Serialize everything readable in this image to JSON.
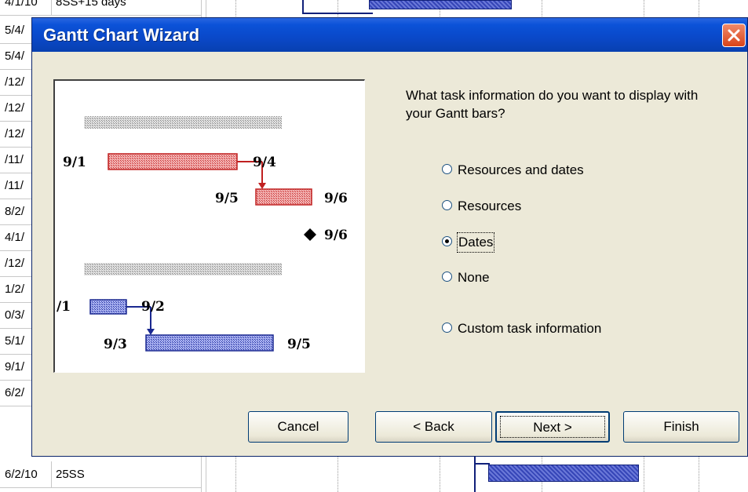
{
  "background_rows": [
    {
      "date": "4/1/10",
      "pred": "8SS+15 days"
    },
    {
      "date": "5/4/",
      "pred": ""
    },
    {
      "date": "5/4/",
      "pred": ""
    },
    {
      "date": "/12/",
      "pred": ""
    },
    {
      "date": "/12/",
      "pred": ""
    },
    {
      "date": "/12/",
      "pred": ""
    },
    {
      "date": "/11/",
      "pred": ""
    },
    {
      "date": "/11/",
      "pred": ""
    },
    {
      "date": "8/2/",
      "pred": ""
    },
    {
      "date": "4/1/",
      "pred": ""
    },
    {
      "date": "/12/",
      "pred": ""
    },
    {
      "date": "1/2/",
      "pred": ""
    },
    {
      "date": "0/3/",
      "pred": ""
    },
    {
      "date": "5/1/",
      "pred": ""
    },
    {
      "date": "9/1/",
      "pred": ""
    },
    {
      "date": "6/2/",
      "pred": ""
    },
    {
      "date": "6/2/10",
      "pred": "25SS"
    }
  ],
  "dialog": {
    "title": "Gantt Chart Wizard",
    "question": "What task information do you want to display with your Gantt bars?",
    "options": [
      {
        "label": "Resources and dates",
        "selected": false
      },
      {
        "label": "Resources",
        "selected": false
      },
      {
        "label": "Dates",
        "selected": true
      },
      {
        "label": "None",
        "selected": false
      },
      {
        "label": "Custom task information",
        "selected": false
      }
    ],
    "buttons": {
      "cancel": "Cancel",
      "back": "< Back",
      "next": "Next >",
      "finish": "Finish"
    }
  },
  "preview": {
    "labels": {
      "red_start": "9/1",
      "red_link": "9/4",
      "red2_start": "9/5",
      "red2_end": "9/6",
      "milestone": "9/6",
      "blue_start": "/1",
      "blue_link": "9/2",
      "blue2_start": "9/3",
      "blue2_end": "9/5"
    }
  },
  "colors": {
    "titlebar": "#0a48c8",
    "dialog_bg": "#ece9d8",
    "critical_bar": "#e35b5b",
    "task_bar": "#3646b8"
  }
}
